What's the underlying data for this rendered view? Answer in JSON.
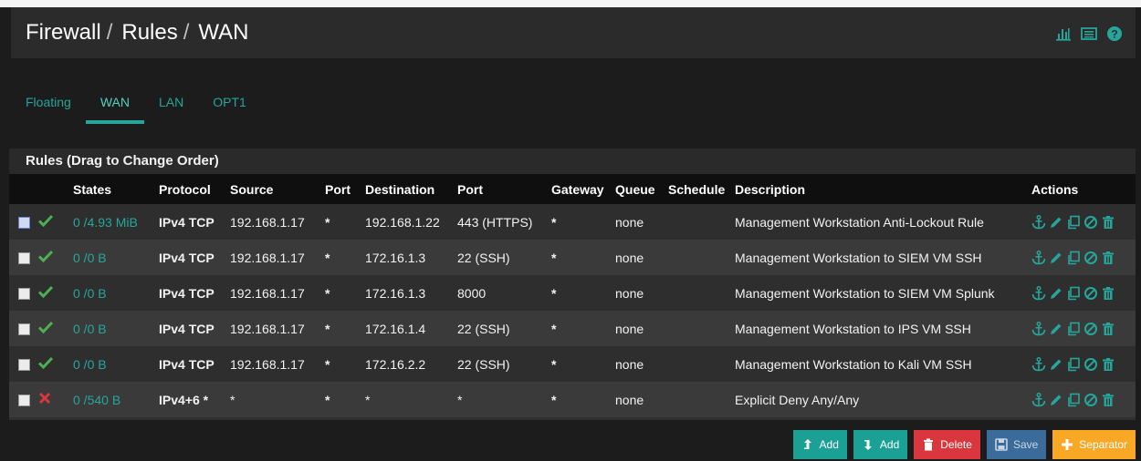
{
  "header": {
    "crumbs": [
      "Firewall",
      "Rules",
      "WAN"
    ],
    "separator": "/",
    "icons": [
      "bar-chart-icon",
      "list-icon",
      "help-icon"
    ]
  },
  "tabs": [
    {
      "label": "Floating",
      "active": false
    },
    {
      "label": "WAN",
      "active": true
    },
    {
      "label": "LAN",
      "active": false
    },
    {
      "label": "OPT1",
      "active": false
    }
  ],
  "panel": {
    "title": "Rules (Drag to Change Order)"
  },
  "table": {
    "columns": [
      "",
      "",
      "States",
      "Protocol",
      "Source",
      "Port",
      "Destination",
      "Port",
      "Gateway",
      "Queue",
      "Schedule",
      "Description",
      "Actions"
    ],
    "rows": [
      {
        "status": "pass",
        "states": "0 /4.93 MiB",
        "protocol": "IPv4 TCP",
        "source": "192.168.1.17",
        "src_port": "*",
        "destination": "192.168.1.22",
        "dst_port": "443 (HTTPS)",
        "gateway": "*",
        "queue": "none",
        "schedule": "",
        "description": "Management Workstation Anti-Lockout Rule"
      },
      {
        "status": "pass",
        "states": "0 /0 B",
        "protocol": "IPv4 TCP",
        "source": "192.168.1.17",
        "src_port": "*",
        "destination": "172.16.1.3",
        "dst_port": "22 (SSH)",
        "gateway": "*",
        "queue": "none",
        "schedule": "",
        "description": "Management Workstation to SIEM VM SSH"
      },
      {
        "status": "pass",
        "states": "0 /0 B",
        "protocol": "IPv4 TCP",
        "source": "192.168.1.17",
        "src_port": "*",
        "destination": "172.16.1.3",
        "dst_port": "8000",
        "gateway": "*",
        "queue": "none",
        "schedule": "",
        "description": "Management Workstation to SIEM VM Splunk"
      },
      {
        "status": "pass",
        "states": "0 /0 B",
        "protocol": "IPv4 TCP",
        "source": "192.168.1.17",
        "src_port": "*",
        "destination": "172.16.1.4",
        "dst_port": "22 (SSH)",
        "gateway": "*",
        "queue": "none",
        "schedule": "",
        "description": "Management Workstation to IPS VM SSH"
      },
      {
        "status": "pass",
        "states": "0 /0 B",
        "protocol": "IPv4 TCP",
        "source": "192.168.1.17",
        "src_port": "*",
        "destination": "172.16.2.2",
        "dst_port": "22 (SSH)",
        "gateway": "*",
        "queue": "none",
        "schedule": "",
        "description": "Management Workstation to Kali VM SSH"
      },
      {
        "status": "block",
        "states": "0 /540 B",
        "protocol": "IPv4+6 *",
        "source": "*",
        "src_port": "*",
        "destination": "*",
        "dst_port": "*",
        "gateway": "*",
        "queue": "none",
        "schedule": "",
        "description": "Explicit Deny Any/Any"
      }
    ]
  },
  "buttons": {
    "add_top": "Add",
    "add_bottom": "Add",
    "delete": "Delete",
    "save": "Save",
    "separator": "Separator"
  },
  "colors": {
    "accent": "#26a69a",
    "pass": "#4caf50",
    "block": "#d9373d",
    "delete": "#d9373d",
    "separator": "#f9a825"
  }
}
